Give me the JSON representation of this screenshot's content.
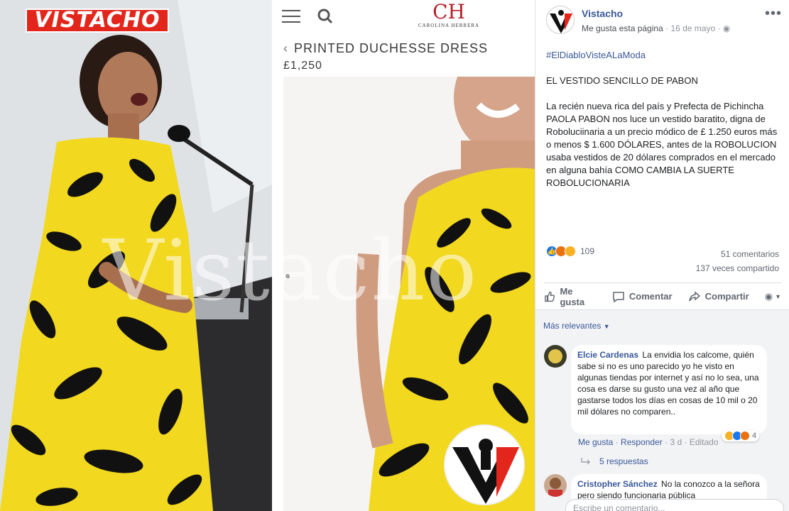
{
  "image": {
    "left_logo_text": "VISTACHO",
    "watermark": "Vistacho",
    "store": {
      "logo_mark": "CH",
      "logo_name": "CAROLINA HERRERA",
      "product_title": "PRINTED DUCHESSE DRESS",
      "price": "£1,250"
    }
  },
  "post": {
    "page_name": "Vistacho",
    "like_page": "Me gusta esta página",
    "date": "16 de mayo",
    "hashtag": "#ElDiabloVisteALaModa",
    "heading": "EL VESTIDO SENCILLO DE PABON",
    "body": "La recién nueva rica del país y Prefecta de Pichincha PAOLA PABON nos luce un vestido baratito, digna de Roboluciinaria a un precio módico de £ 1.250 euros más o menos $ 1.600 DÓLARES, antes de la ROBOLUCION usaba vestidos de 20 dólares comprados en el mercado en alguna bahía COMO CAMBIA LA SUERTE ROBOLUCIONARIA",
    "reaction_count": "109",
    "comment_count": "51 comentarios",
    "share_count": "137 veces compartido"
  },
  "actions": {
    "like": "Me gusta",
    "comment": "Comentar",
    "share": "Compartir"
  },
  "comments": {
    "sort_label": "Más relevantes",
    "items": [
      {
        "author": "Elcie Cardenas",
        "text": "La envidia los calcome, quién sabe si no es uno parecido yo he visto en algunas tiendas por internet y así no lo sea, una cosa es darse su gusto una vez al año que gastarse todos los días en cosas de 10 mil o 20 mil dólares no comparen..",
        "like": "Me gusta",
        "reply": "Responder",
        "time": "3 d",
        "edited": "Editado",
        "reactions": "4",
        "replies": "5 respuestas"
      },
      {
        "author": "Cristopher Sánchez",
        "text": "No la conozco a la señora pero siendo funcionaria pública"
      }
    ],
    "write_placeholder": "Escribe un comentario..."
  },
  "colors": {
    "fb_blue": "#385898",
    "red_logo": "#e3261c",
    "dress_yellow": "#f2d81f"
  }
}
